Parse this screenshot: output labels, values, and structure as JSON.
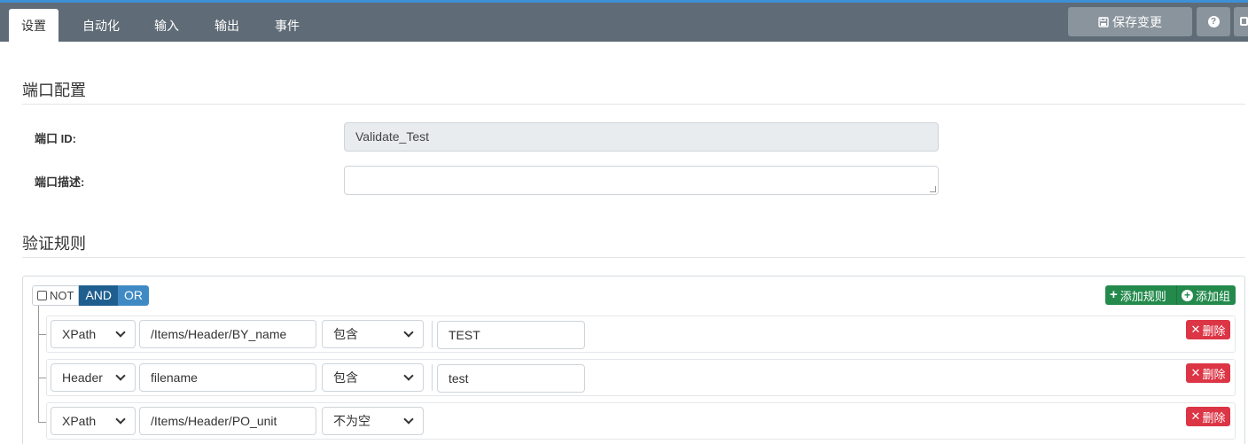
{
  "tabs": [
    {
      "label": "设置",
      "active": true
    },
    {
      "label": "自动化"
    },
    {
      "label": "输入"
    },
    {
      "label": "输出"
    },
    {
      "label": "事件"
    }
  ],
  "toolbar": {
    "save_label": "保存变更",
    "save_icon": "floppy-icon",
    "help_icon": "question-circle-icon",
    "help_glyph": "?"
  },
  "port_config": {
    "title": "端口配置",
    "id_label": "端口 ID:",
    "id_value": "Validate_Test",
    "desc_label": "端口描述:",
    "desc_value": ""
  },
  "validation": {
    "title": "验证规则",
    "not_label": "NOT",
    "and_label": "AND",
    "or_label": "OR",
    "add_rule_label": "添加规则",
    "add_group_label": "添加组",
    "delete_label": "删除",
    "rules": [
      {
        "type": "XPath",
        "path": "/Items/Header/BY_name",
        "operator": "包含",
        "value": "TEST"
      },
      {
        "type": "Header",
        "path": "filename",
        "operator": "包含",
        "value": "test"
      },
      {
        "type": "XPath",
        "path": "/Items/Header/PO_unit",
        "operator": "不为空",
        "value": ""
      }
    ]
  },
  "colors": {
    "topbar": "#5f6b76",
    "accent": "#3d8fd6",
    "and": "#1f5f8f",
    "or": "#3f8ac4",
    "success": "#238a4c",
    "danger": "#dc3545"
  }
}
